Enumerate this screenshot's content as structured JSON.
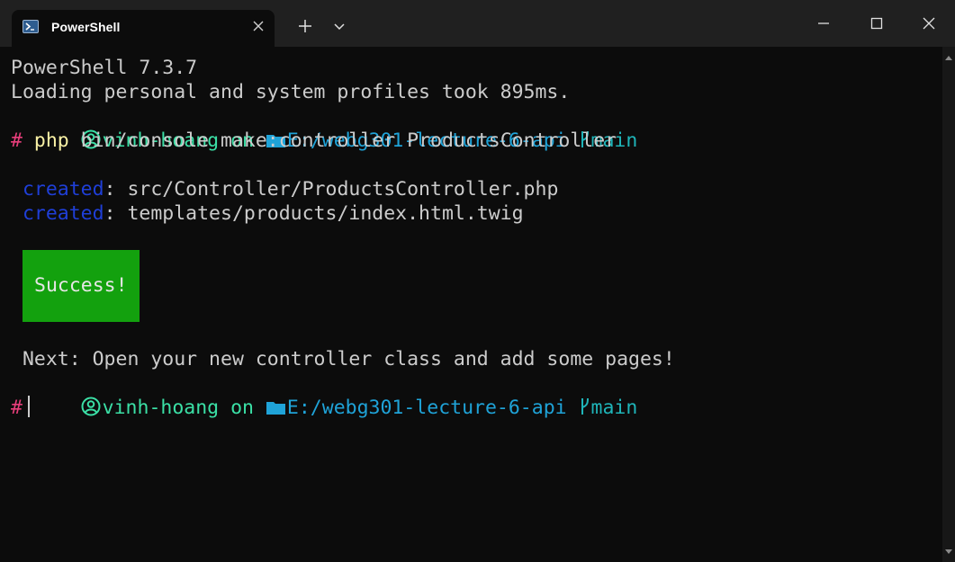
{
  "titlebar": {
    "tab_title": "PowerShell",
    "tab_icon": "powershell-icon",
    "new_tab_icon": "plus-icon",
    "dropdown_icon": "chevron-down-icon",
    "minimize_icon": "minimize-icon",
    "maximize_icon": "maximize-icon",
    "close_icon": "close-icon"
  },
  "terminal": {
    "version_line": "PowerShell 7.3.7",
    "profile_line": "Loading personal and system profiles took 895ms.",
    "prompt1": {
      "user": "vinh-hoang",
      "on": "on",
      "path": "E:/webg301-lecture-6-api",
      "branch": "main"
    },
    "command": {
      "hash": "#",
      "program": "php",
      "args": "bin/console make:controller ProductsController"
    },
    "created1": {
      "label": "created",
      "path": ": src/Controller/ProductsController.php"
    },
    "created2": {
      "label": "created",
      "path": ": templates/products/index.html.twig"
    },
    "success": "Success!",
    "next_line": "Next: Open your new controller class and add some pages!",
    "prompt2": {
      "user": "vinh-hoang",
      "on": "on",
      "path": "E:/webg301-lecture-6-api",
      "branch": "main"
    },
    "prompt2_hash": "#"
  },
  "colors": {
    "background": "#0c0c0c",
    "titlebar": "#202020",
    "text": "#cccccc",
    "user": "#3be0a6",
    "path": "#1fa3d8",
    "branch": "#1fb5b9",
    "hash": "#e83e7b",
    "php": "#f9f1a5",
    "created": "#1f3fd8",
    "success_bg": "#13a10e"
  }
}
